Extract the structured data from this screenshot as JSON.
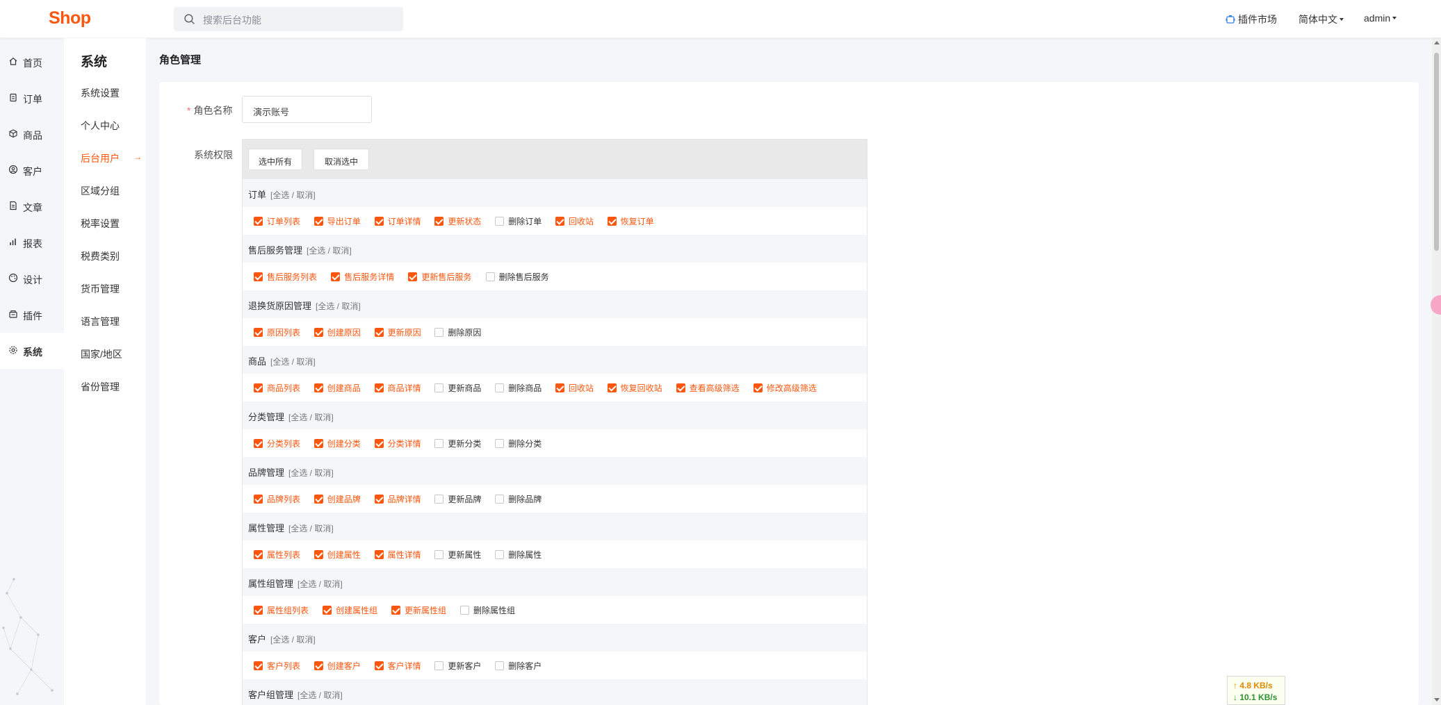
{
  "header": {
    "logo": "Shop",
    "search_placeholder": "搜索后台功能",
    "plugin_market": "插件市场",
    "language": "简体中文",
    "user": "admin"
  },
  "main_nav": [
    {
      "label": "首页",
      "icon": "home-icon"
    },
    {
      "label": "订单",
      "icon": "clipboard-icon"
    },
    {
      "label": "商品",
      "icon": "box-icon"
    },
    {
      "label": "客户",
      "icon": "user-circle-icon"
    },
    {
      "label": "文章",
      "icon": "document-icon"
    },
    {
      "label": "报表",
      "icon": "bar-chart-icon"
    },
    {
      "label": "设计",
      "icon": "palette-icon"
    },
    {
      "label": "插件",
      "icon": "plugin-icon"
    },
    {
      "label": "系统",
      "icon": "gear-icon",
      "active": true
    }
  ],
  "sub_nav": {
    "title": "系统",
    "items": [
      "系统设置",
      "个人中心",
      "后台用户",
      "区域分组",
      "税率设置",
      "税费类别",
      "货币管理",
      "语言管理",
      "国家/地区",
      "省份管理"
    ],
    "active_index": 2,
    "active_arrow": "→"
  },
  "page": {
    "title": "角色管理",
    "name_label": "角色名称",
    "required_mark": "*",
    "name_value": "演示账号",
    "perm_label": "系统权限",
    "select_all": "选中所有",
    "deselect": "取消选中",
    "toggle_text": "[全选 / 取消]"
  },
  "groups": [
    {
      "title": "订单",
      "items": [
        {
          "label": "订单列表",
          "checked": true
        },
        {
          "label": "导出订单",
          "checked": true
        },
        {
          "label": "订单详情",
          "checked": true
        },
        {
          "label": "更新状态",
          "checked": true
        },
        {
          "label": "删除订单",
          "checked": false
        },
        {
          "label": "回收站",
          "checked": true
        },
        {
          "label": "恢复订单",
          "checked": true
        }
      ]
    },
    {
      "title": "售后服务管理",
      "items": [
        {
          "label": "售后服务列表",
          "checked": true
        },
        {
          "label": "售后服务详情",
          "checked": true
        },
        {
          "label": "更新售后服务",
          "checked": true
        },
        {
          "label": "删除售后服务",
          "checked": false
        }
      ]
    },
    {
      "title": "退换货原因管理",
      "items": [
        {
          "label": "原因列表",
          "checked": true
        },
        {
          "label": "创建原因",
          "checked": true
        },
        {
          "label": "更新原因",
          "checked": true
        },
        {
          "label": "删除原因",
          "checked": false
        }
      ]
    },
    {
      "title": "商品",
      "items": [
        {
          "label": "商品列表",
          "checked": true
        },
        {
          "label": "创建商品",
          "checked": true
        },
        {
          "label": "商品详情",
          "checked": true
        },
        {
          "label": "更新商品",
          "checked": false
        },
        {
          "label": "删除商品",
          "checked": false
        },
        {
          "label": "回收站",
          "checked": true
        },
        {
          "label": "恢复回收站",
          "checked": true
        },
        {
          "label": "查看高级筛选",
          "checked": true
        },
        {
          "label": "修改高级筛选",
          "checked": true
        }
      ]
    },
    {
      "title": "分类管理",
      "items": [
        {
          "label": "分类列表",
          "checked": true
        },
        {
          "label": "创建分类",
          "checked": true
        },
        {
          "label": "分类详情",
          "checked": true
        },
        {
          "label": "更新分类",
          "checked": false
        },
        {
          "label": "删除分类",
          "checked": false
        }
      ]
    },
    {
      "title": "品牌管理",
      "items": [
        {
          "label": "品牌列表",
          "checked": true
        },
        {
          "label": "创建品牌",
          "checked": true
        },
        {
          "label": "品牌详情",
          "checked": true
        },
        {
          "label": "更新品牌",
          "checked": false
        },
        {
          "label": "删除品牌",
          "checked": false
        }
      ]
    },
    {
      "title": "属性管理",
      "items": [
        {
          "label": "属性列表",
          "checked": true
        },
        {
          "label": "创建属性",
          "checked": true
        },
        {
          "label": "属性详情",
          "checked": true
        },
        {
          "label": "更新属性",
          "checked": false
        },
        {
          "label": "删除属性",
          "checked": false
        }
      ]
    },
    {
      "title": "属性组管理",
      "items": [
        {
          "label": "属性组列表",
          "checked": true
        },
        {
          "label": "创建属性组",
          "checked": true
        },
        {
          "label": "更新属性组",
          "checked": true
        },
        {
          "label": "删除属性组",
          "checked": false
        }
      ]
    },
    {
      "title": "客户",
      "items": [
        {
          "label": "客户列表",
          "checked": true
        },
        {
          "label": "创建客户",
          "checked": true
        },
        {
          "label": "客户详情",
          "checked": true
        },
        {
          "label": "更新客户",
          "checked": false
        },
        {
          "label": "删除客户",
          "checked": false
        }
      ]
    },
    {
      "title": "客户组管理",
      "items": []
    }
  ],
  "net_speed": {
    "up": "↑ 4.8 KB/s",
    "down": "↓ 10.1 KB/s"
  },
  "colors": {
    "accent": "#fd560f",
    "required": "#f56c6c"
  }
}
